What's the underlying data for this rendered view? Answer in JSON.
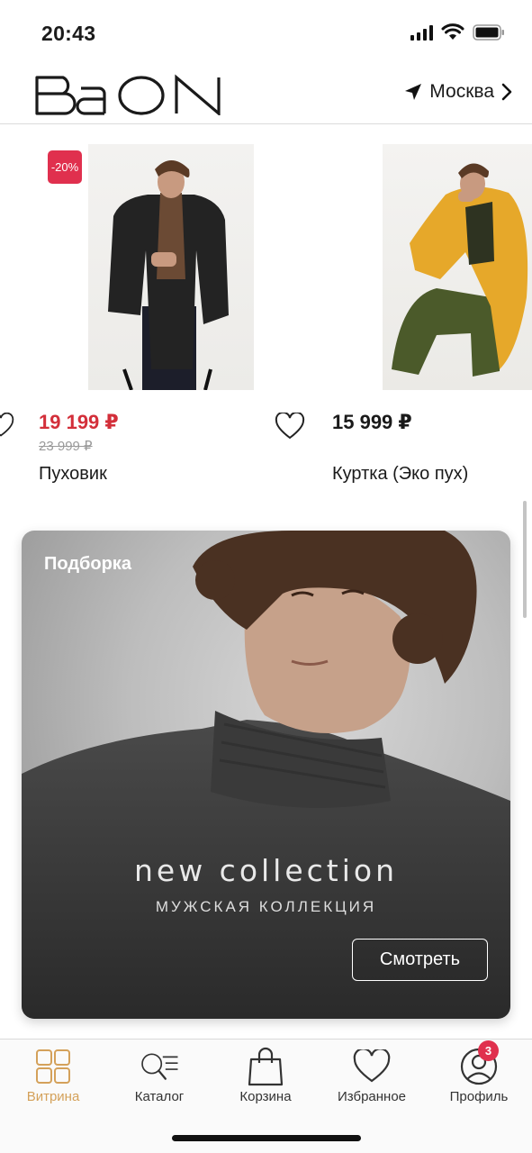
{
  "status_bar": {
    "time": "20:43"
  },
  "header": {
    "logo_text": "BaON",
    "city": "Москва"
  },
  "products": [
    {
      "badge": "-20%",
      "price": "19 199 ₽",
      "old_price": "23 999 ₽",
      "name": "Пуховик"
    },
    {
      "price": "15 999 ₽",
      "name": "Куртка (Эко пух)"
    }
  ],
  "banner": {
    "tag": "Подборка",
    "title": "new collection",
    "subtitle": "МУЖСКАЯ КОЛЛЕКЦИЯ",
    "button": "Смотреть"
  },
  "tabbar": {
    "items": [
      {
        "label": "Витрина",
        "icon": "grid-icon",
        "active": true
      },
      {
        "label": "Каталог",
        "icon": "catalog-search-icon"
      },
      {
        "label": "Корзина",
        "icon": "shopping-bag-icon"
      },
      {
        "label": "Избранное",
        "icon": "heart-icon"
      },
      {
        "label": "Профиль",
        "icon": "profile-icon"
      }
    ],
    "profile_badge": "3"
  },
  "colors": {
    "accent": "#d4a15a",
    "sale": "#d32f3a",
    "badge": "#e0304e"
  }
}
